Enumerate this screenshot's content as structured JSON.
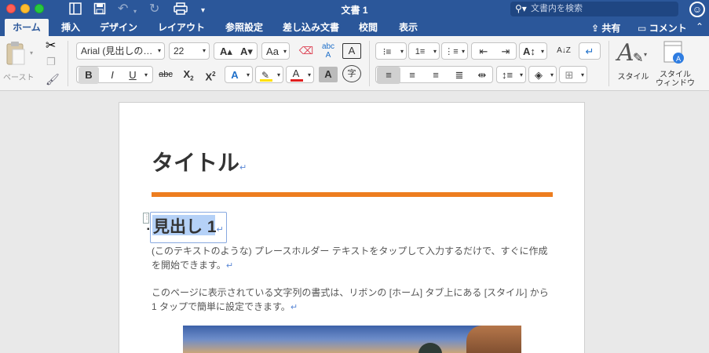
{
  "window": {
    "title": "文書 1",
    "search_placeholder": "文書内を検索"
  },
  "tabs": [
    {
      "label": "ホーム"
    },
    {
      "label": "挿入"
    },
    {
      "label": "デザイン"
    },
    {
      "label": "レイアウト"
    },
    {
      "label": "参照設定"
    },
    {
      "label": "差し込み文書"
    },
    {
      "label": "校閲"
    },
    {
      "label": "表示"
    }
  ],
  "header_actions": {
    "share": "共有",
    "comment": "コメント"
  },
  "ribbon": {
    "paste_label": "ペースト",
    "font_name": "Arial (見出しの…",
    "font_size": "22",
    "styles_label": "スタイル",
    "style_window_label": "スタイル\nウィンドウ",
    "style_window_line1": "スタイル",
    "style_window_line2": "ウィンドウ"
  },
  "document": {
    "title": "タイトル",
    "heading": "見出し 1",
    "para1": "(このテキストのような) プレースホルダー テキストをタップして入力するだけで、すぐに作成を開始できます。",
    "para2": "このページに表示されている文字列の書式は、リボンの [ホーム] タブ上にある [スタイル] から 1 タップで簡単に設定できます。"
  },
  "colors": {
    "ribbon_blue": "#2b579a",
    "accent_orange": "#ed7d1f",
    "highlight_yellow": "#ffff00",
    "font_red": "#e02020"
  }
}
